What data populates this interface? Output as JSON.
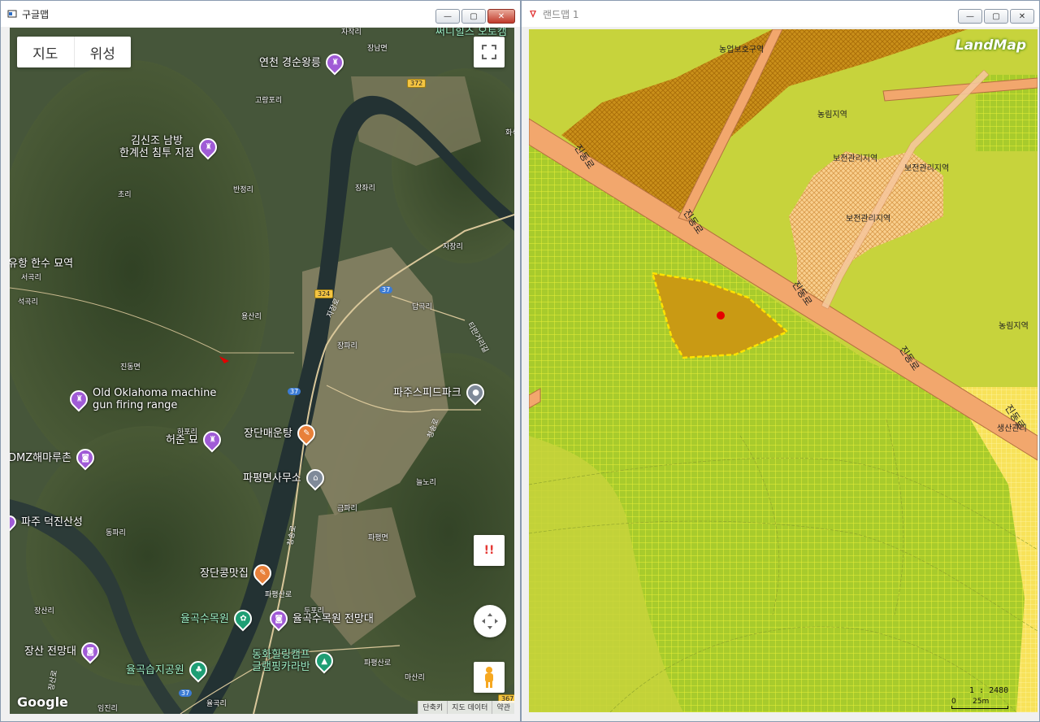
{
  "google_window": {
    "title": "구글맵",
    "minimize": "—",
    "maximize": "▢",
    "close": "✕",
    "map_type": {
      "map_label": "지도",
      "satellite_label": "위성",
      "selected": "위성"
    },
    "fullscreen_icon": "fullscreen-icon",
    "alert_text": "!!",
    "logo": "Google",
    "footer": [
      "단축키",
      "지도 데이터",
      "약관"
    ],
    "pois": [
      {
        "label": "연천 경순왕릉",
        "icon": "monument-icon",
        "color": "#a05bd6"
      },
      {
        "label": "김신조 남방\n한계선 침투 지점",
        "icon": "monument-icon",
        "color": "#a05bd6"
      },
      {
        "label": "유항 한수 묘역",
        "icon": "",
        "color": ""
      },
      {
        "label": "Old Oklahoma machine\ngun firing range",
        "icon": "monument-icon",
        "color": "#a05bd6"
      },
      {
        "label": "허준 묘",
        "icon": "monument-icon",
        "color": "#a05bd6"
      },
      {
        "label": "DMZ해마루촌",
        "icon": "camera-icon",
        "color": "#a05bd6"
      },
      {
        "label": "파주 덕진산성",
        "icon": "monument-icon",
        "color": "#a05bd6"
      },
      {
        "label": "장단매운탕",
        "icon": "restaurant-icon",
        "color": "#e8803a"
      },
      {
        "label": "파평면사무소",
        "icon": "government-icon",
        "color": "#7f8a99"
      },
      {
        "label": "파주스피드파크",
        "icon": "place-icon",
        "color": "#7f8a99"
      },
      {
        "label": "장단콩맛집",
        "icon": "restaurant-icon",
        "color": "#e8803a"
      },
      {
        "label": "율곡수목원",
        "icon": "flower-icon",
        "color": "#1e9e74"
      },
      {
        "label": "율곡수목원 전망대",
        "icon": "camera-icon",
        "color": "#a05bd6"
      },
      {
        "label": "장산 전망대",
        "icon": "camera-icon",
        "color": "#a05bd6"
      },
      {
        "label": "율곡습지공원",
        "icon": "tree-icon",
        "color": "#1e9e74"
      },
      {
        "label": "동화힐링캠프\n글램핑카라반",
        "icon": "camp-icon",
        "color": "#1e9e74"
      },
      {
        "label": "써니힐즈 오토캠",
        "icon": "",
        "color": ""
      }
    ],
    "places": [
      "장남면",
      "고랑포리",
      "반정리",
      "초리",
      "장좌리",
      "자장리",
      "서곡리",
      "석곡리",
      "용산리",
      "답곡리",
      "장파리",
      "진동면",
      "하포리",
      "늘노리",
      "금파리",
      "동파리",
      "파평면",
      "두포리",
      "파평산로",
      "장산리",
      "마산리",
      "임진리",
      "율곡리",
      "자작리",
      "화석정"
    ],
    "road_numbers": [
      "372",
      "324",
      "37",
      "37",
      "37",
      "367"
    ],
    "road_names": [
      "자장로",
      "티란거리길",
      "청송로",
      "청송로",
      "파평산로",
      "장산로"
    ]
  },
  "landmap_window": {
    "title": "랜드맵 1",
    "minimize": "—",
    "maximize": "▢",
    "close": "✕",
    "logo": "LandMap",
    "zones": [
      "농업보호구역",
      "농림지역",
      "보전관리지역",
      "보전관리지역",
      "보전관리지역",
      "농림지역",
      "생산관리"
    ],
    "roads": [
      "진동로",
      "진동로",
      "진동로",
      "진동로",
      "진동로"
    ],
    "scale_label": "1 : 2480",
    "scale_bar": [
      "0",
      "25m"
    ],
    "colors": {
      "agri": "#c7d33c",
      "protect": "#c98f1a",
      "preserve": "#f9cf8e",
      "road": "#f2a76d",
      "parcel": "#c99a14",
      "marker": "#e60000"
    }
  }
}
